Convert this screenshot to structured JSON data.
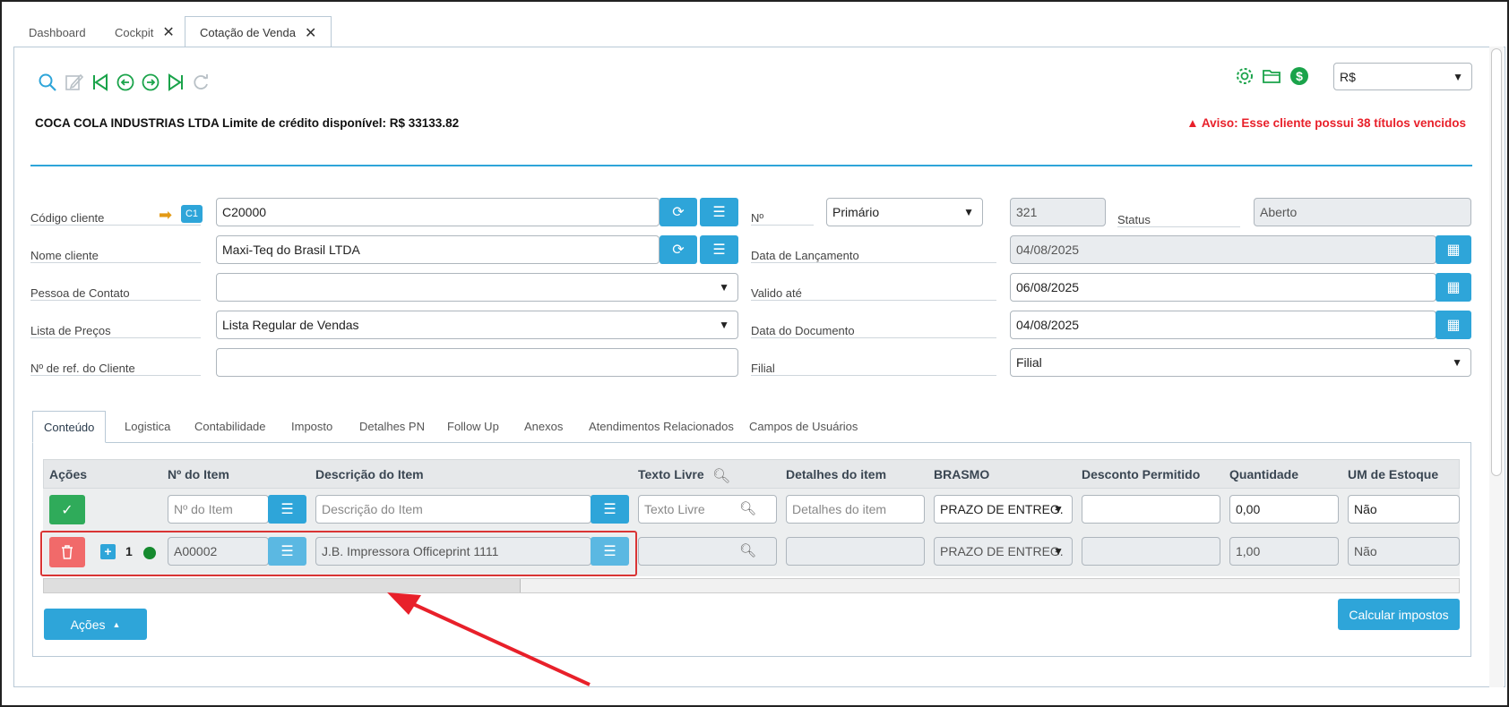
{
  "tabs": [
    {
      "label": "Dashboard"
    },
    {
      "label": "Cockpit"
    },
    {
      "label": "Cotação de Venda"
    }
  ],
  "currency": "R$",
  "header": {
    "customer_credit": "COCA COLA INDUSTRIAS LTDA Limite de crédito disponível: R$ 33133.82",
    "warning": "Aviso: Esse cliente possui 38 títulos vencidos"
  },
  "form": {
    "codigo_cliente_label": "Código cliente",
    "codigo_cliente_badge": "C1",
    "codigo_cliente_value": "C20000",
    "nome_cliente_label": "Nome cliente",
    "nome_cliente_value": "Maxi-Teq do Brasil LTDA",
    "pessoa_contato_label": "Pessoa de Contato",
    "lista_precos_label": "Lista de Preços",
    "lista_precos_value": "Lista Regular de Vendas",
    "ref_cliente_label": "Nº de ref. do Cliente",
    "numero_label": "Nº",
    "numero_series": "Primário",
    "numero_value": "321",
    "status_label": "Status",
    "status_value": "Aberto",
    "data_lancamento_label": "Data de Lançamento",
    "data_lancamento_value": "04/08/2025",
    "valido_ate_label": "Valido até",
    "valido_ate_value": "06/08/2025",
    "data_documento_label": "Data do Documento",
    "data_documento_value": "04/08/2025",
    "filial_label": "Filial",
    "filial_value": "Filial"
  },
  "panel_tabs": [
    {
      "label": "Conteúdo"
    },
    {
      "label": "Logistica"
    },
    {
      "label": "Contabilidade"
    },
    {
      "label": "Imposto"
    },
    {
      "label": "Detalhes PN"
    },
    {
      "label": "Follow Up"
    },
    {
      "label": "Anexos"
    },
    {
      "label": "Atendimentos Relacionados"
    },
    {
      "label": "Campos de Usuários"
    }
  ],
  "grid": {
    "headers": [
      "Ações",
      "Nº do Item",
      "Descrição do Item",
      "Texto Livre",
      "Detalhes do item",
      "BRASMO",
      "Desconto Permitido",
      "Quantidade",
      "UM de Estoque"
    ],
    "new_row": {
      "item_placeholder": "Nº do Item",
      "desc_placeholder": "Descrição do Item",
      "texto_placeholder": "Texto Livre",
      "detalhes_placeholder": "Detalhes do item",
      "brasmo": "PRAZO DE ENTREG.",
      "quantidade": "0,00",
      "um": "Não"
    },
    "rows": [
      {
        "line": "1",
        "item": "A00002",
        "desc": "J.B. Impressora Officeprint 1111",
        "brasmo": "PRAZO DE ENTREG.",
        "quantidade": "1,00",
        "um": "Não"
      }
    ]
  },
  "buttons": {
    "acoes": "Ações",
    "calcular": "Calcular impostos"
  },
  "colors": {
    "accent": "#2ea5d9",
    "warning": "#e8202a",
    "success": "#1aa34a",
    "danger": "#f16a6a"
  }
}
